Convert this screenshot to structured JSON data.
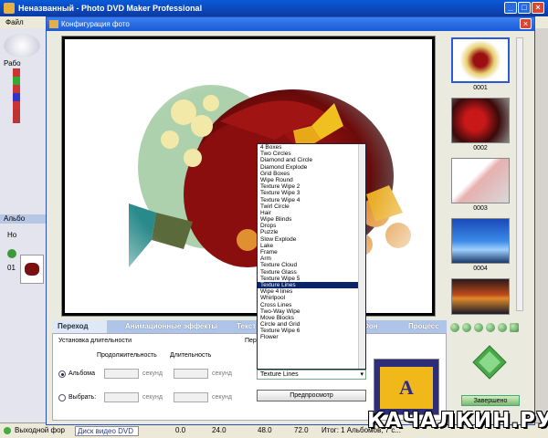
{
  "main": {
    "title": "Неназванный - Photo DVD Maker Professional",
    "menu": [
      "Файл"
    ],
    "left_tree_header": "Рабо",
    "left_tab": "Альбо",
    "left_sub": "Но",
    "left_num": "01",
    "status": {
      "left_text": "Выходной фор",
      "format_value": "Диск видео DVD",
      "ruler": [
        "0.0",
        "24.0",
        "48.0",
        "72.0"
      ],
      "right_text": "Итог: 1 Альбомов, 7 с..."
    }
  },
  "dialog": {
    "title": "Конфигурация фото",
    "tabs": [
      "Переход",
      "Анимационные эффекты",
      "Текст",
      "Фон",
      "Процесс"
    ],
    "active_tab": 0,
    "section_label": "Установка длительности",
    "headers": {
      "duration": "Продолжительность",
      "length": "Длительность"
    },
    "radio_all": "Альбома",
    "radio_selected": "Выбрать:",
    "unit_seconds": "секунд",
    "effect_label": "Переход",
    "effect_selected": "Texture Lines",
    "preview_button": "Предпросмотр",
    "done_button": "Завершено",
    "transitions": [
      "4 Boxes",
      "Two Circles",
      "Diamond and Circle",
      "Diamond Explode",
      "Grid Boxes",
      "Wipe Round",
      "Texture Wipe 2",
      "Texture Wipe 3",
      "Texture Wipe 4",
      "Twirl Circle",
      "Hair",
      "Wipe Blinds",
      "Drops",
      "Puzzle",
      "Slow Explode",
      "Lake",
      "Frame",
      "Arm",
      "Texture Cloud",
      "Texture Glass",
      "Texture Wipe 5",
      "Texture Lines",
      "Wipe 4 lines",
      "Whirlpool",
      "Cross Lines",
      "Two-Way Wipe",
      "Move Blocks",
      "Circle and Grid",
      "Texture Wipe 6",
      "Flower"
    ],
    "selected_transition_index": 21,
    "thumbnails": [
      "0001",
      "0002",
      "0003",
      "0004"
    ],
    "tile_letter": "A"
  },
  "watermark": "КАЧАЛКИН.РУ",
  "colors": {
    "titlebar": "#0b46b8",
    "selection": "#0a246a",
    "tile_yellow": "#f0b818"
  }
}
